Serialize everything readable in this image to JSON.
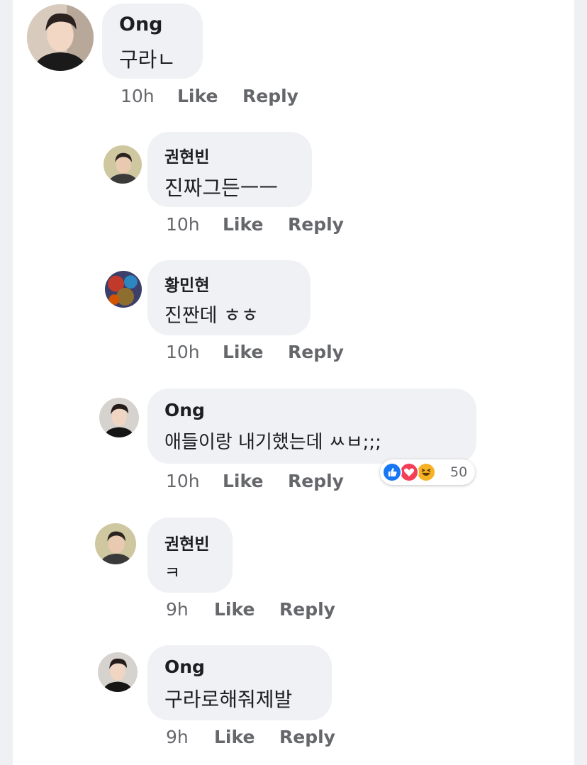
{
  "comments": [
    {
      "author": "Ong",
      "text": "구라ㄴ",
      "time": "10h",
      "like": "Like",
      "reply": "Reply"
    },
    {
      "author": "권현빈",
      "text": "진짜그든ㅡㅡ",
      "time": "10h",
      "like": "Like",
      "reply": "Reply"
    },
    {
      "author": "황민현",
      "text": "진짠데 ㅎㅎ",
      "time": "10h",
      "like": "Like",
      "reply": "Reply"
    },
    {
      "author": "Ong",
      "text": "애들이랑 내기했는데 ㅆㅂ;;;",
      "time": "10h",
      "like": "Like",
      "reply": "Reply",
      "reactions": {
        "icons": [
          "like-icon",
          "love-icon",
          "haha-icon"
        ],
        "count": "50"
      }
    },
    {
      "author": "권현빈",
      "text": "ㅋ",
      "time": "9h",
      "like": "Like",
      "reply": "Reply"
    },
    {
      "author": "Ong",
      "text": "구라로해줘제발",
      "time": "9h",
      "like": "Like",
      "reply": "Reply"
    }
  ],
  "colors": {
    "like": "#1877f2",
    "love": "#f33e58",
    "haha": "#f7b125",
    "bubble": "#f0f1f5",
    "meta": "#65676b"
  }
}
